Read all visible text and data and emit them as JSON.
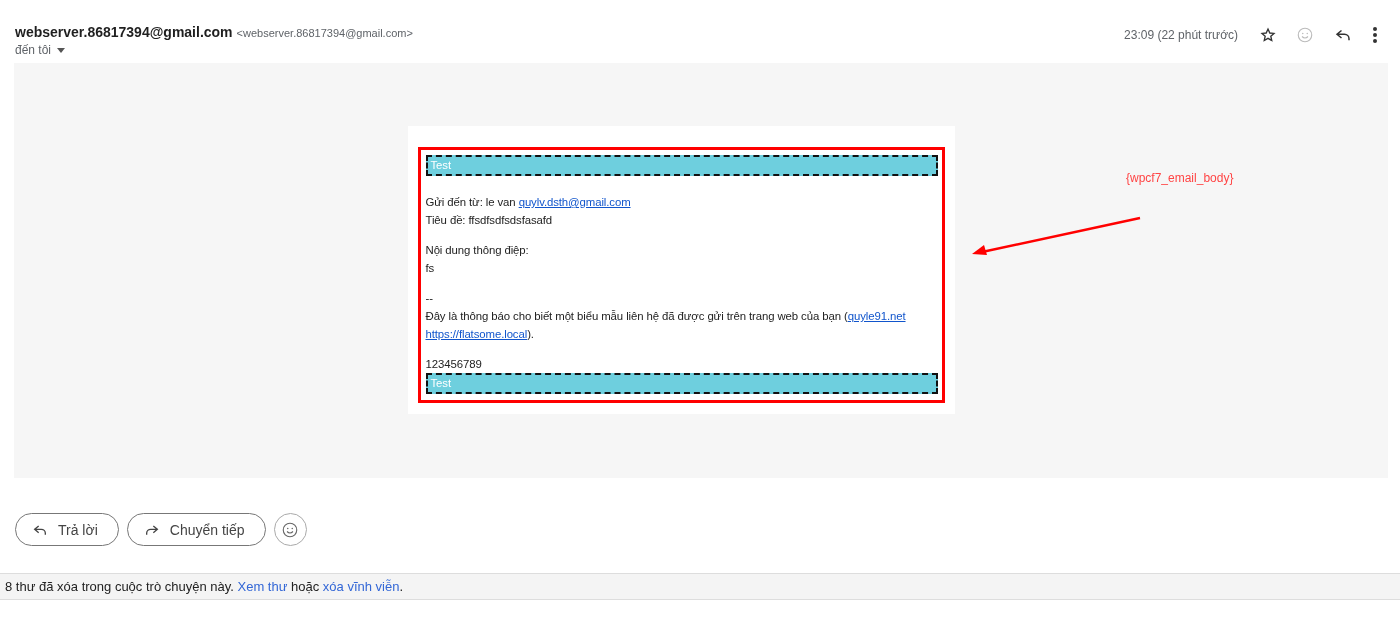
{
  "header": {
    "sender_name": "webserver.86817394@gmail.com",
    "sender_address": "<webserver.86817394@gmail.com>",
    "recipient": "đến tôi",
    "time": "23:09 (22 phút trước)",
    "starred": false
  },
  "email_body": {
    "banner_top": "Test",
    "sender_line": {
      "text": "Gửi đến từ: le van ",
      "link": "quylv.dsth@gmail.com"
    },
    "subject_line": "Tiêu đề: ffsdfsdfsdsfasafd",
    "message_label": "Nội dung thông điệp:",
    "message": "fs",
    "separator": "--",
    "notice": {
      "text": "Đây là thông báo cho biết một biểu mẫu liên hệ đã được gửi trên trang web của bạn (",
      "link_1": "quyle91.net",
      "link_2": "https://flatsome.local",
      "end": ")."
    },
    "phone": "123456789",
    "banner_bottom": "Test"
  },
  "annotation": "{wpcf7_email_body}",
  "actions": [
    {
      "label": "Trả lời",
      "kind": "reply"
    },
    {
      "label": "Chuyển tiếp",
      "kind": "forward"
    }
  ],
  "footer": {
    "text": "8 thư đã xóa trong cuộc trò chuyện này. ",
    "link_1": "Xem thư",
    "middle": " hoặc ",
    "link_2": "xóa vĩnh viễn",
    "end": "."
  }
}
